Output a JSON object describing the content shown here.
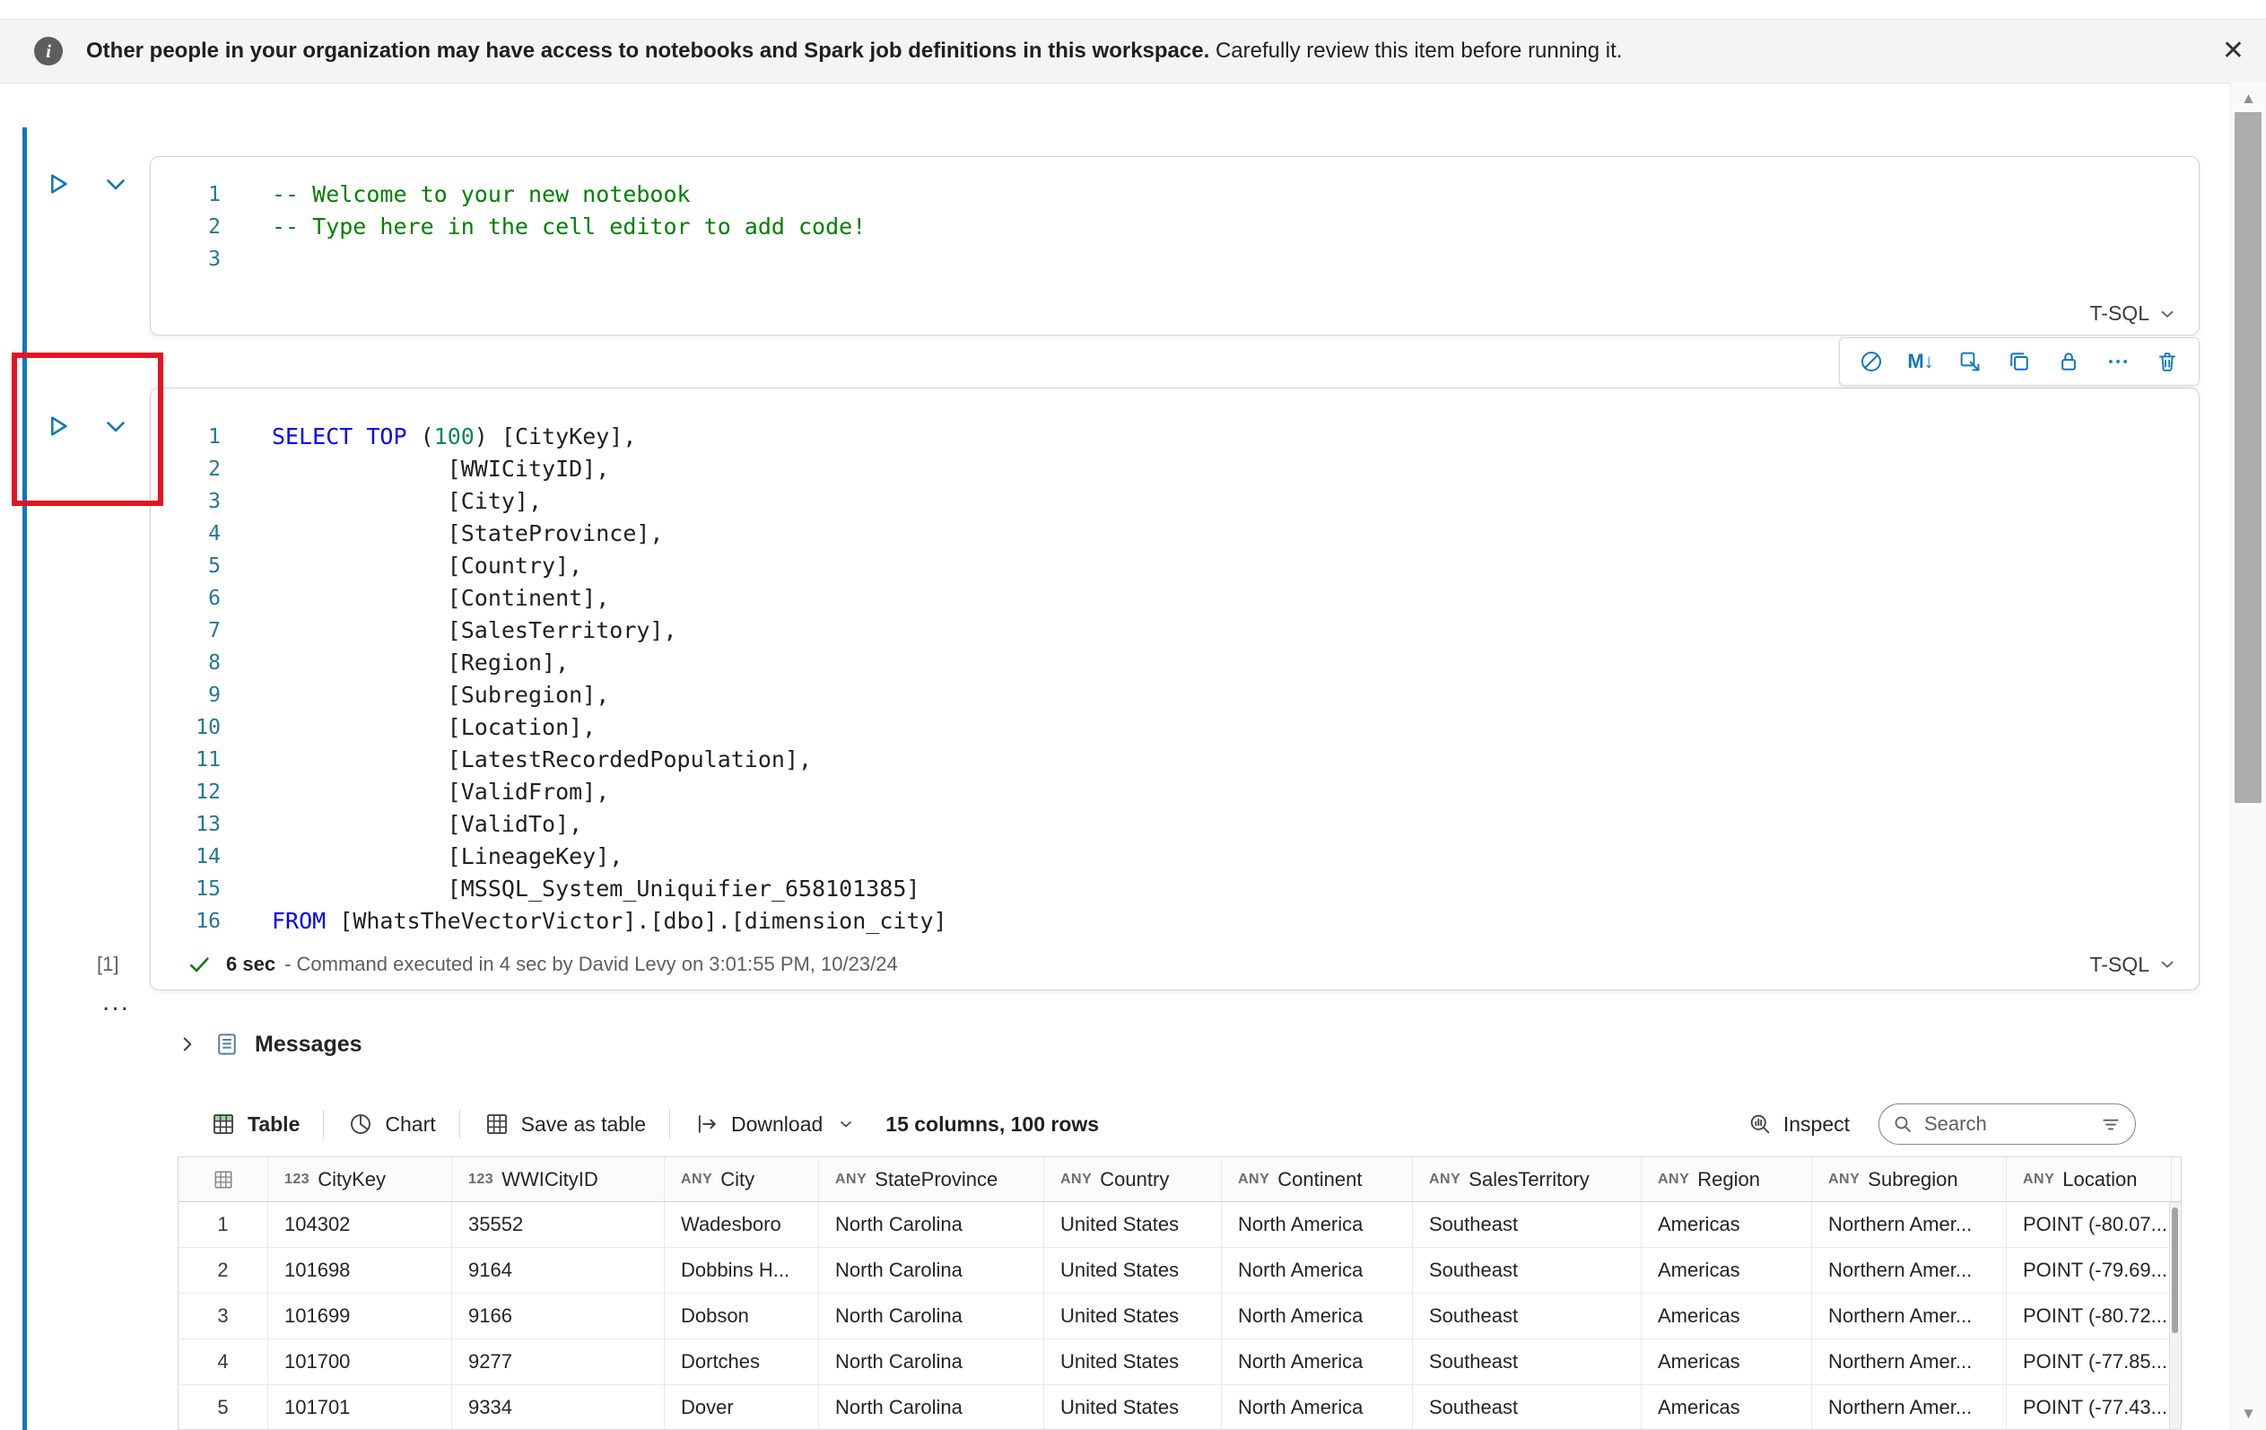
{
  "banner": {
    "info_icon": "i",
    "bold_text": "Other people in your organization may have access to notebooks and Spark job definitions in this workspace.",
    "regular_text": "Carefully review this item before running it.",
    "close_icon": "✕"
  },
  "cells": {
    "cell1": {
      "lang_label": "T-SQL",
      "lines": [
        {
          "num": "1",
          "tokens": [
            {
              "text": "-- Welcome to your new notebook",
              "type": "comment"
            }
          ]
        },
        {
          "num": "2",
          "tokens": [
            {
              "text": "-- Type here in the cell editor to add code!",
              "type": "comment"
            }
          ]
        },
        {
          "num": "3",
          "tokens": []
        }
      ]
    },
    "cell2": {
      "lang_label": "T-SQL",
      "toolbar_icons": [
        "toggle-parameter-cell-icon",
        "convert-to-markdown-icon",
        "hide-input-icon",
        "duplicate-cell-icon",
        "freeze-cell-icon",
        "more-commands-icon",
        "delete-cell-icon"
      ],
      "lines": [
        {
          "num": "1",
          "tokens": [
            {
              "text": "SELECT",
              "type": "keyword"
            },
            {
              "text": " ",
              "type": "plain"
            },
            {
              "text": "TOP",
              "type": "keyword"
            },
            {
              "text": " (",
              "type": "plain"
            },
            {
              "text": "100",
              "type": "number"
            },
            {
              "text": ") [CityKey],",
              "type": "plain"
            }
          ]
        },
        {
          "num": "2",
          "tokens": [
            {
              "text": "             [WWICityID],",
              "type": "plain"
            }
          ]
        },
        {
          "num": "3",
          "tokens": [
            {
              "text": "             [City],",
              "type": "plain"
            }
          ]
        },
        {
          "num": "4",
          "tokens": [
            {
              "text": "             [StateProvince],",
              "type": "plain"
            }
          ]
        },
        {
          "num": "5",
          "tokens": [
            {
              "text": "             [Country],",
              "type": "plain"
            }
          ]
        },
        {
          "num": "6",
          "tokens": [
            {
              "text": "             [Continent],",
              "type": "plain"
            }
          ]
        },
        {
          "num": "7",
          "tokens": [
            {
              "text": "             [SalesTerritory],",
              "type": "plain"
            }
          ]
        },
        {
          "num": "8",
          "tokens": [
            {
              "text": "             [Region],",
              "type": "plain"
            }
          ]
        },
        {
          "num": "9",
          "tokens": [
            {
              "text": "             [Subregion],",
              "type": "plain"
            }
          ]
        },
        {
          "num": "10",
          "tokens": [
            {
              "text": "             [Location],",
              "type": "plain"
            }
          ]
        },
        {
          "num": "11",
          "tokens": [
            {
              "text": "             [LatestRecordedPopulation],",
              "type": "plain"
            }
          ]
        },
        {
          "num": "12",
          "tokens": [
            {
              "text": "             [ValidFrom],",
              "type": "plain"
            }
          ]
        },
        {
          "num": "13",
          "tokens": [
            {
              "text": "             [ValidTo],",
              "type": "plain"
            }
          ]
        },
        {
          "num": "14",
          "tokens": [
            {
              "text": "             [LineageKey],",
              "type": "plain"
            }
          ]
        },
        {
          "num": "15",
          "tokens": [
            {
              "text": "             [MSSQL_System_Uniquifier_658101385]",
              "type": "plain"
            }
          ]
        },
        {
          "num": "16",
          "tokens": [
            {
              "text": "FROM",
              "type": "keyword"
            },
            {
              "text": " [WhatsTheVectorVictor].[dbo].[dimension_city]",
              "type": "plain"
            }
          ]
        }
      ],
      "execution": {
        "index_label": "[1]",
        "duration": "6 sec",
        "detail": "- Command executed in 4 sec by David Levy on 3:01:55 PM, 10/23/24"
      },
      "collapsed_indicator": "..."
    }
  },
  "messages": {
    "label": "Messages"
  },
  "results_toolbar": {
    "table_tab": "Table",
    "chart_tab": "Chart",
    "save_as_table": "Save as table",
    "download": "Download",
    "summary": "15 columns, 100 rows",
    "inspect": "Inspect",
    "search_placeholder": "Search"
  },
  "table": {
    "columns": [
      {
        "type_badge": "123",
        "name": "CityKey"
      },
      {
        "type_badge": "123",
        "name": "WWICityID"
      },
      {
        "type_badge": "ANY",
        "name": "City"
      },
      {
        "type_badge": "ANY",
        "name": "StateProvince"
      },
      {
        "type_badge": "ANY",
        "name": "Country"
      },
      {
        "type_badge": "ANY",
        "name": "Continent"
      },
      {
        "type_badge": "ANY",
        "name": "SalesTerritory"
      },
      {
        "type_badge": "ANY",
        "name": "Region"
      },
      {
        "type_badge": "ANY",
        "name": "Subregion"
      },
      {
        "type_badge": "ANY",
        "name": "Location"
      }
    ],
    "rows": [
      {
        "index": "1",
        "cells": [
          "104302",
          "35552",
          "Wadesboro",
          "North Carolina",
          "United States",
          "North America",
          "Southeast",
          "Americas",
          "Northern Amer...",
          "POINT (-80.07..."
        ]
      },
      {
        "index": "2",
        "cells": [
          "101698",
          "9164",
          "Dobbins H...",
          "North Carolina",
          "United States",
          "North America",
          "Southeast",
          "Americas",
          "Northern Amer...",
          "POINT (-79.69..."
        ]
      },
      {
        "index": "3",
        "cells": [
          "101699",
          "9166",
          "Dobson",
          "North Carolina",
          "United States",
          "North America",
          "Southeast",
          "Americas",
          "Northern Amer...",
          "POINT (-80.72..."
        ]
      },
      {
        "index": "4",
        "cells": [
          "101700",
          "9277",
          "Dortches",
          "North Carolina",
          "United States",
          "North America",
          "Southeast",
          "Americas",
          "Northern Amer...",
          "POINT (-77.85..."
        ]
      },
      {
        "index": "5",
        "cells": [
          "101701",
          "9334",
          "Dover",
          "North Carolina",
          "United States",
          "North America",
          "Southeast",
          "Americas",
          "Northern Amer...",
          "POINT (-77.43..."
        ]
      }
    ]
  },
  "colors": {
    "accent_blue": "#1177bb",
    "keyword_blue": "#0000ff",
    "comment_green": "#008000",
    "number_green": "#098658",
    "line_number_teal": "#237893",
    "success_green": "#107c10",
    "annotation_red": "#e81123"
  }
}
